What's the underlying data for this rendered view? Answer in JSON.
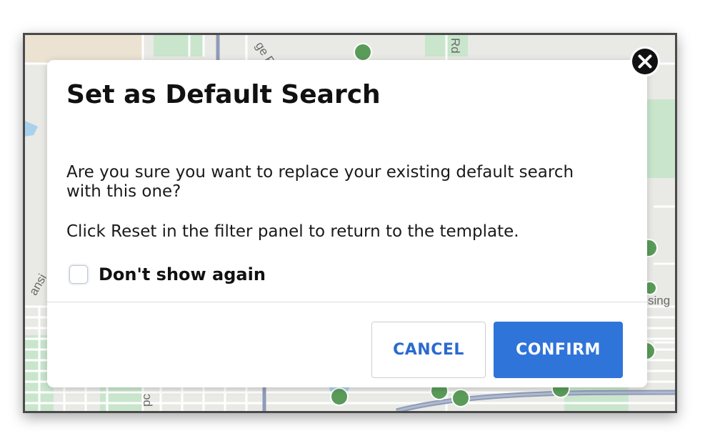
{
  "modal": {
    "title": "Set as Default Search",
    "message_line1": "Are you sure you want to replace your existing default search with this one?",
    "message_line2": "Click Reset in the filter panel to return to the template.",
    "checkbox_label": "Don't show again",
    "checkbox_checked": false,
    "cancel_label": "CANCEL",
    "confirm_label": "CONFIRM",
    "close_icon": "close-x-icon"
  },
  "map": {
    "labels": {
      "top_road_a": "ge Ro",
      "top_road_b": "Rd",
      "left_road": "ansi",
      "right_road": "sing",
      "bottom_road": "pc"
    }
  },
  "colors": {
    "accent": "#2f74d9",
    "park": "#c7e5cc",
    "marker": "#5a9b5a",
    "highway": "#8f9bb7",
    "water": "#a8d1ee"
  }
}
